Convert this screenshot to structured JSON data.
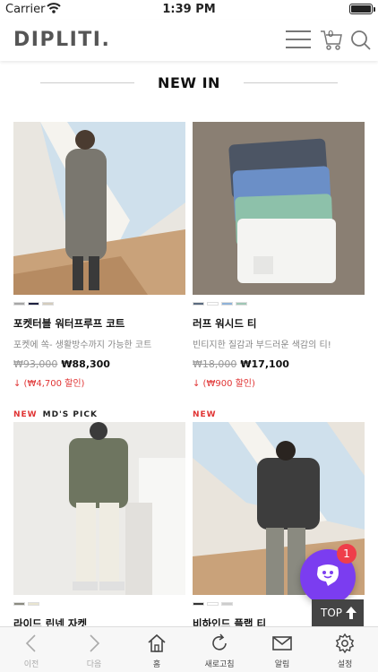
{
  "status": {
    "carrier": "Carrier",
    "time": "1:39 PM"
  },
  "header": {
    "logo": "DIPLITI.",
    "cart_count": "0"
  },
  "section": {
    "title": "NEW IN"
  },
  "products": [
    {
      "name": "포켓터블 워터프루프 코트",
      "desc": "포켓에 쏙- 생활방수까지 가능한 코트",
      "orig": "₩93,000",
      "sale": "₩88,300",
      "discount": "↓ (₩4,700 할인)",
      "badge_new": "NEW",
      "badge_md": "MD'S PICK",
      "swatches": [
        "#a6a6a6",
        "#1e2140",
        "#d4ccbe"
      ]
    },
    {
      "name": "러프 워시드 티",
      "desc": "빈티지한 질감과 부드러운 색감의 티!",
      "orig": "₩18,000",
      "sale": "₩17,100",
      "discount": "↓ (₩900 할인)",
      "badge_new": "NEW",
      "swatches": [
        "#5b6b80",
        "#ffffff",
        "#8fb2d9",
        "#9fc7b5"
      ]
    },
    {
      "name": "라이드 린넨 자켓",
      "swatches": [
        "#8a8a80",
        "#e8e4d0"
      ]
    },
    {
      "name": "비하인드 플랩 티",
      "swatches": [
        "#333333",
        "#ffffff",
        "#cccccc"
      ]
    }
  ],
  "chat": {
    "badge": "1"
  },
  "top_button": {
    "label": "TOP"
  },
  "tabs": [
    {
      "label": "이전",
      "icon": "chevron-left-icon"
    },
    {
      "label": "다음",
      "icon": "chevron-right-icon"
    },
    {
      "label": "홈",
      "icon": "home-icon"
    },
    {
      "label": "새로고침",
      "icon": "refresh-icon"
    },
    {
      "label": "알림",
      "icon": "mail-icon"
    },
    {
      "label": "설정",
      "icon": "gear-icon"
    }
  ],
  "colors": {
    "accent": "#7b3df0",
    "sale_red": "#e03434",
    "badge_red": "#ef3e4a"
  }
}
